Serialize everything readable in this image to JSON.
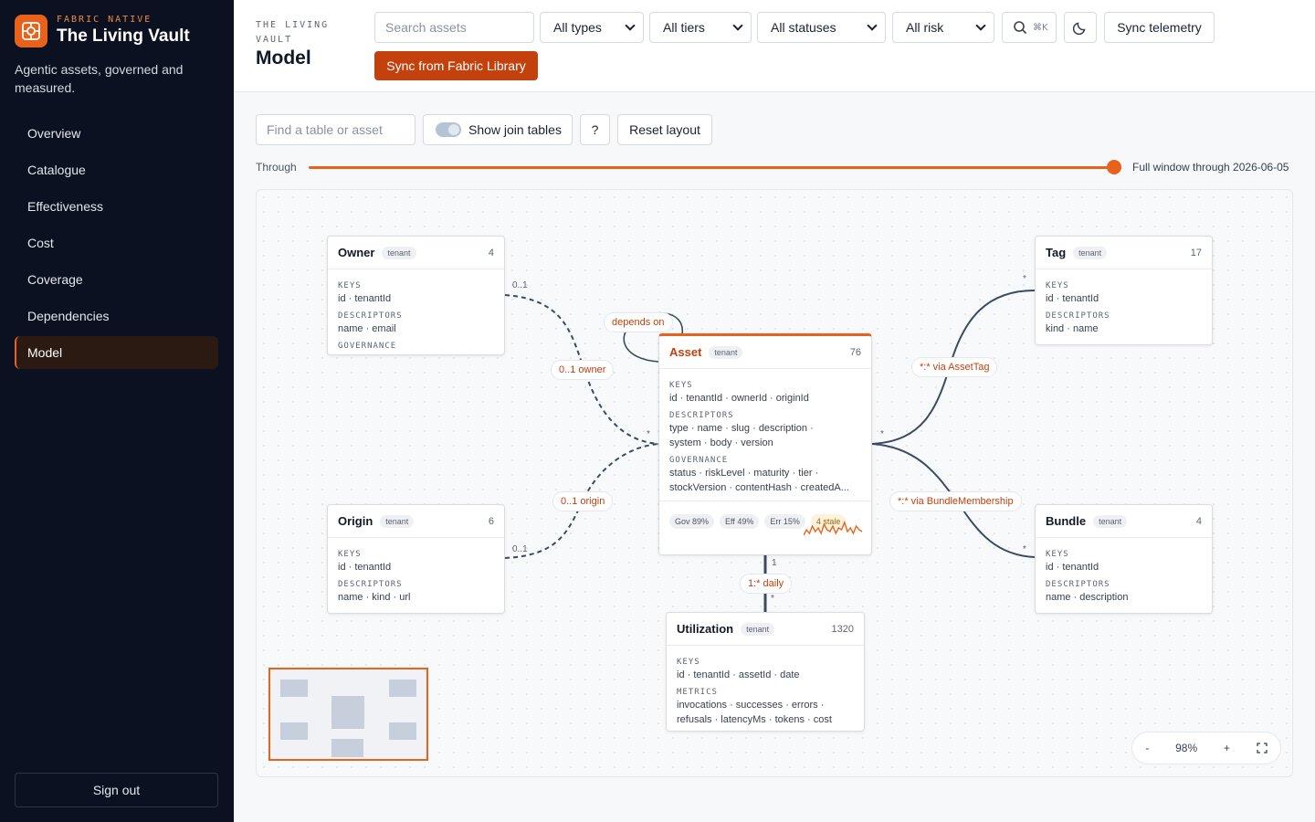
{
  "brand": {
    "eyebrow": "FABRIC NATIVE",
    "title": "The Living Vault",
    "tagline": "Agentic assets, governed and measured."
  },
  "nav": [
    {
      "label": "Overview"
    },
    {
      "label": "Catalogue"
    },
    {
      "label": "Effectiveness"
    },
    {
      "label": "Cost"
    },
    {
      "label": "Coverage"
    },
    {
      "label": "Dependencies"
    },
    {
      "label": "Model",
      "active": true
    }
  ],
  "sign_out": "Sign out",
  "header": {
    "eyebrow": "THE LIVING VAULT",
    "title": "Model",
    "search_placeholder": "Search assets",
    "filters": {
      "types": "All types",
      "tiers": "All tiers",
      "statuses": "All statuses",
      "risk": "All risk"
    },
    "shortcut": "⌘K",
    "sync_telemetry": "Sync telemetry",
    "sync_fabric": "Sync from Fabric Library"
  },
  "toolbar": {
    "find_placeholder": "Find a table or asset",
    "show_join_tables": "Show join tables",
    "show_join_tables_on": false,
    "help": "?",
    "reset_layout": "Reset layout",
    "through_label": "Through",
    "window_label": "Full window through 2026-06-05",
    "slider_fraction": 1.0
  },
  "tables": {
    "owner": {
      "name": "Owner",
      "tag": "tenant",
      "count": "4",
      "keys_label": "KEYS",
      "keys": "id · tenantId",
      "descriptors_label": "DESCRIPTORS",
      "descriptors": "name · email",
      "governance_label": "GOVERNANCE"
    },
    "tag": {
      "name": "Tag",
      "tag": "tenant",
      "count": "17",
      "keys_label": "KEYS",
      "keys": "id · tenantId",
      "descriptors_label": "DESCRIPTORS",
      "descriptors": "kind · name"
    },
    "asset": {
      "name": "Asset",
      "tag": "tenant",
      "count": "76",
      "keys_label": "KEYS",
      "keys": "id · tenantId · ownerId · originId",
      "descriptors_label": "DESCRIPTORS",
      "descriptors_1": "type · name · slug · description ·",
      "descriptors_2": "system · body · version",
      "governance_label": "GOVERNANCE",
      "governance_1": "status · riskLevel · maturity · tier ·",
      "governance_2": "stockVersion · contentHash · createdA...",
      "pills": {
        "gov": "Gov 89%",
        "eff": "Eff 49%",
        "err": "Err 15%",
        "stale": "4 stale"
      },
      "sparkline": [
        2,
        5,
        3,
        7,
        4,
        6,
        3,
        8,
        5,
        4,
        7,
        3,
        6,
        5,
        9,
        4,
        6,
        3,
        7,
        5,
        4
      ]
    },
    "origin": {
      "name": "Origin",
      "tag": "tenant",
      "count": "6",
      "keys_label": "KEYS",
      "keys": "id · tenantId",
      "descriptors_label": "DESCRIPTORS",
      "descriptors": "name · kind · url"
    },
    "bundle": {
      "name": "Bundle",
      "tag": "tenant",
      "count": "4",
      "keys_label": "KEYS",
      "keys": "id · tenantId",
      "descriptors_label": "DESCRIPTORS",
      "descriptors": "name · description"
    },
    "utilization": {
      "name": "Utilization",
      "tag": "tenant",
      "count": "1320",
      "keys_label": "KEYS",
      "keys": "id · tenantId · assetId · date",
      "metrics_label": "METRICS",
      "metrics_1": "invocations · successes · errors ·",
      "metrics_2": "refusals · latencyMs · tokens · cost"
    }
  },
  "edges": {
    "depends_on": "depends on",
    "owner": "0..1 owner",
    "origin": "0..1 origin",
    "asset_tag": "*:* via AssetTag",
    "bundle_membership": "*:* via BundleMembership",
    "daily": "1:* daily",
    "card_owner": "0..1",
    "card_origin": "0..1",
    "star": "*",
    "one": "1"
  },
  "zoom": {
    "minus": "-",
    "level": "98%",
    "plus": "+"
  },
  "colors": {
    "accent": "#e8621b",
    "sidebar": "#0b1120",
    "edge": "#3b4a60"
  }
}
